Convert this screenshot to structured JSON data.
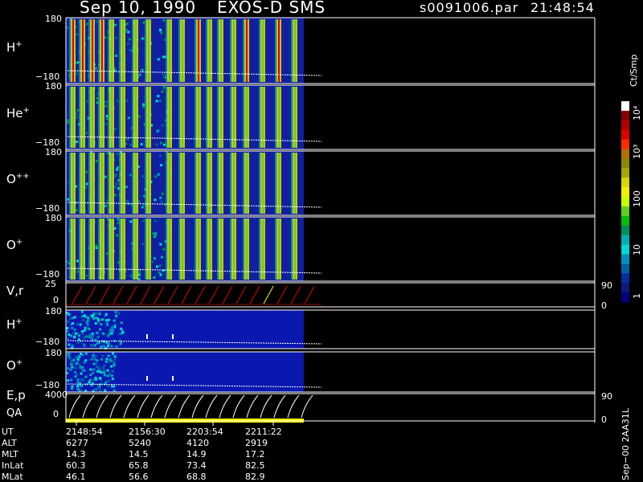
{
  "header": {
    "date": "Sep 10, 1990",
    "instrument": "EXOS-D SMS",
    "file": "s0091006.par",
    "time": "21:48:54"
  },
  "panels": [
    {
      "label": "H",
      "sup": "+",
      "top_tick": "180",
      "bottom_tick": "−180"
    },
    {
      "label": "He",
      "sup": "+",
      "top_tick": "180",
      "bottom_tick": "−180"
    },
    {
      "label": "O",
      "sup": "++",
      "top_tick": "180",
      "bottom_tick": "−180"
    },
    {
      "label": "O",
      "sup": "+",
      "top_tick": "180",
      "bottom_tick": "−180"
    },
    {
      "label": "V,r",
      "sup": "",
      "top_tick": "25",
      "bottom_tick": "0",
      "right_top": "90",
      "right_bottom": "0"
    },
    {
      "label": "H",
      "sup": "+",
      "top_tick": "180",
      "bottom_tick": "−180"
    },
    {
      "label": "O",
      "sup": "+",
      "top_tick": "180",
      "bottom_tick": "−180"
    },
    {
      "label": "E,p",
      "sup": "",
      "top_tick": "4000",
      "bottom_tick": "0",
      "right_top": "90",
      "right_bottom": "0"
    }
  ],
  "qa_label": "QA",
  "colorbar": {
    "unit": "Ct/Smp",
    "tick_labels": [
      "10⁴",
      "10³",
      "100",
      "10",
      "1"
    ],
    "colors": [
      "#ffffff",
      "#8a0000",
      "#b40000",
      "#e00000",
      "#ff2a00",
      "#b07000",
      "#8a8a00",
      "#a8a800",
      "#d8d800",
      "#f0f000",
      "#c8ff00",
      "#60d020",
      "#00c000",
      "#009060",
      "#00b0b0",
      "#00d8d8",
      "#0090c0",
      "#0060a0",
      "#0030a0",
      "#101880",
      "#000080"
    ]
  },
  "footer": {
    "rows": [
      {
        "label": "UT",
        "values": [
          "2148:54",
          "2156:30",
          "2203:54",
          "2211:22"
        ]
      },
      {
        "label": "ALT",
        "values": [
          "6277",
          "5240",
          "4120",
          "2919"
        ]
      },
      {
        "label": "MLT",
        "values": [
          "14.3",
          "14.5",
          "14.9",
          "17.2"
        ]
      },
      {
        "label": "InLat",
        "values": [
          "60.3",
          "65.8",
          "73.4",
          "82.5"
        ]
      },
      {
        "label": "MLat",
        "values": [
          "46.1",
          "56.6",
          "68.8",
          "82.9"
        ]
      }
    ],
    "side_text": "Sep−00  2AA31L"
  },
  "chart_data": {
    "type": "heatmap",
    "title": "Sep 10, 1990 EXOS-D SMS",
    "time_ticks_ut": [
      "2148:54",
      "2156:30",
      "2203:54",
      "2211:22"
    ],
    "panels": [
      {
        "species": "H+",
        "ylim": [
          -180,
          180
        ],
        "stripe_count": 16
      },
      {
        "species": "He+",
        "ylim": [
          -180,
          180
        ],
        "stripe_count": 14
      },
      {
        "species": "O++",
        "ylim": [
          -180,
          180
        ],
        "stripe_count": 14
      },
      {
        "species": "O+",
        "ylim": [
          -180,
          180
        ],
        "stripe_count": 14
      },
      {
        "species": "V,r",
        "ylim": [
          0,
          25
        ],
        "right_ylim": [
          0,
          90
        ]
      },
      {
        "species": "H+",
        "ylim": [
          -180,
          180
        ]
      },
      {
        "species": "O+",
        "ylim": [
          -180,
          180
        ]
      },
      {
        "species": "E,p",
        "ylim": [
          0,
          4000
        ],
        "right_ylim": [
          0,
          90
        ]
      }
    ],
    "colorbar_range": [
      1,
      10000
    ],
    "colorbar_scale": "log",
    "colorbar_unit": "Ct/Smp"
  }
}
